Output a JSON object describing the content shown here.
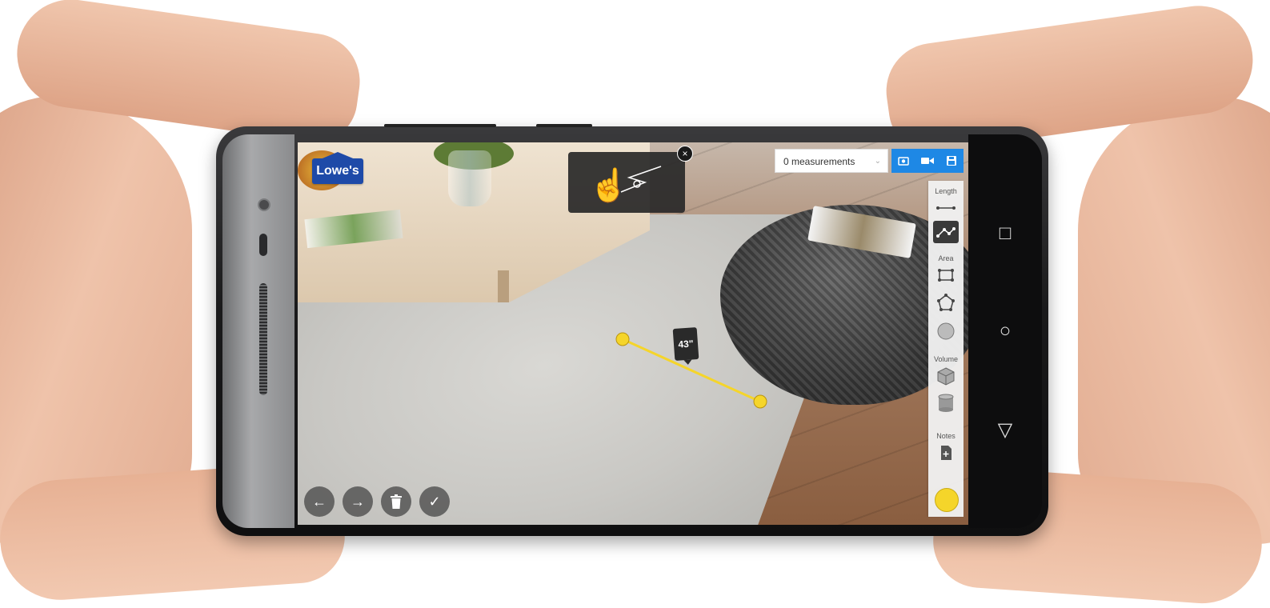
{
  "app": {
    "logo_text": "Lowe's"
  },
  "toolbar": {
    "measurements_select": "0 measurements",
    "buttons": [
      {
        "icon": "camera-icon"
      },
      {
        "icon": "video-icon"
      },
      {
        "icon": "save-icon"
      }
    ]
  },
  "tutorial": {
    "close_label": "×",
    "icon": "tap-hand-icon"
  },
  "tools": {
    "sections": [
      {
        "label": "Length",
        "tools": [
          "line-tool-icon",
          "polyline-tool-icon"
        ]
      },
      {
        "label": "Area",
        "tools": [
          "rectangle-area-icon",
          "polygon-area-icon",
          "circle-area-icon"
        ]
      },
      {
        "label": "Volume",
        "tools": [
          "cube-volume-icon",
          "cylinder-volume-icon"
        ]
      },
      {
        "label": "Notes",
        "tools": [
          "note-add-icon"
        ]
      }
    ],
    "active_tool": "polyline-tool-icon",
    "color": "#f5d52a"
  },
  "measurement": {
    "label": "43\""
  },
  "bottom_bar": {
    "buttons": [
      {
        "icon": "undo-arrow-icon",
        "glyph": "←"
      },
      {
        "icon": "redo-arrow-icon",
        "glyph": "→"
      },
      {
        "icon": "trash-icon",
        "glyph": "🗑"
      },
      {
        "icon": "check-icon",
        "glyph": "✓"
      }
    ]
  },
  "android_nav": {
    "recent": "□",
    "home": "○",
    "back": "▽"
  },
  "colors": {
    "accent_blue": "#1e88e5",
    "measure_yellow": "#f5d52a",
    "brand_blue": "#1e4aa8"
  }
}
